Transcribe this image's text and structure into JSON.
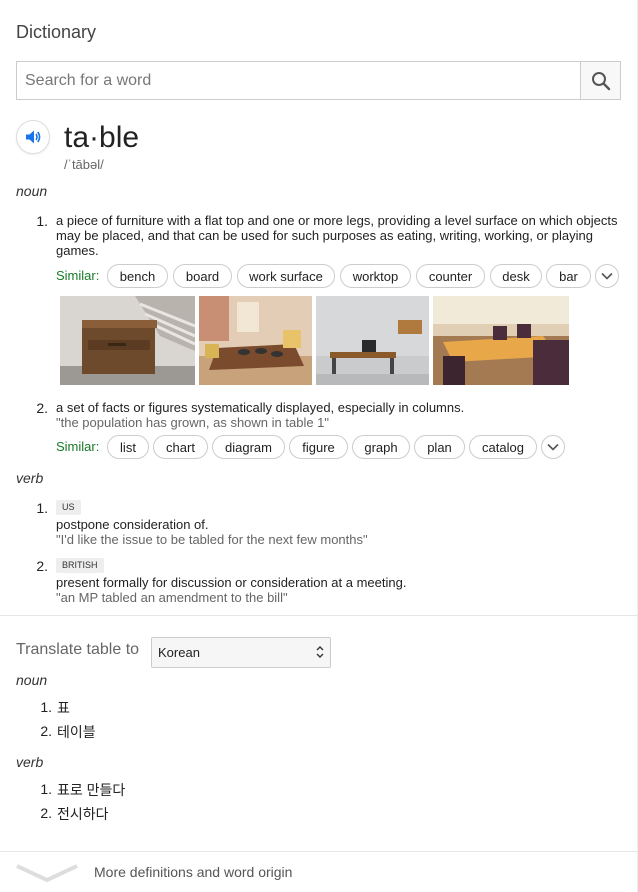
{
  "header": {
    "title": "Dictionary"
  },
  "search": {
    "placeholder": "Search for a word"
  },
  "entry": {
    "word": "ta·ble",
    "phonetic": "/ˈtābəl/"
  },
  "noun": {
    "pos": "noun",
    "senses": [
      {
        "num": "1.",
        "definition": "a piece of furniture with a flat top and one or more legs, providing a level surface on which objects may be placed, and that can be used for such purposes as eating, writing, working, or playing games.",
        "similar_label": "Similar:",
        "similar": [
          "bench",
          "board",
          "work surface",
          "worktop",
          "counter",
          "desk",
          "bar"
        ]
      },
      {
        "num": "2.",
        "definition": "a set of facts or figures systematically displayed, especially in columns.",
        "example": "\"the population has grown, as shown in table 1\"",
        "similar_label": "Similar:",
        "similar": [
          "list",
          "chart",
          "diagram",
          "figure",
          "graph",
          "plan",
          "catalog"
        ]
      }
    ],
    "images": [
      "bedside-table-photo",
      "dining-table-photo",
      "office-desk-photo",
      "restaurant-tables-photo"
    ]
  },
  "verb": {
    "pos": "verb",
    "senses": [
      {
        "num": "1.",
        "tag": "US",
        "definition": "postpone consideration of.",
        "example": "\"I'd like the issue to be tabled for the next few months\""
      },
      {
        "num": "2.",
        "tag": "BRITISH",
        "definition": "present formally for discussion or consideration at a meeting.",
        "example": "\"an MP tabled an amendment to the bill\""
      }
    ]
  },
  "translate": {
    "label": "Translate table to",
    "language": "Korean",
    "noun_pos": "noun",
    "noun_items": [
      {
        "num": "1.",
        "text": "표"
      },
      {
        "num": "2.",
        "text": "테이블"
      }
    ],
    "verb_pos": "verb",
    "verb_items": [
      {
        "num": "1.",
        "text": "표로 만들다"
      },
      {
        "num": "2.",
        "text": "전시하다"
      }
    ]
  },
  "footer": {
    "more": "More definitions and word origin"
  },
  "colors": {
    "accent": "#1a73e8",
    "similar_green": "#1a7a2a"
  },
  "icons": [
    "search-icon",
    "speaker-icon",
    "chevron-down-icon",
    "select-arrows-icon"
  ]
}
